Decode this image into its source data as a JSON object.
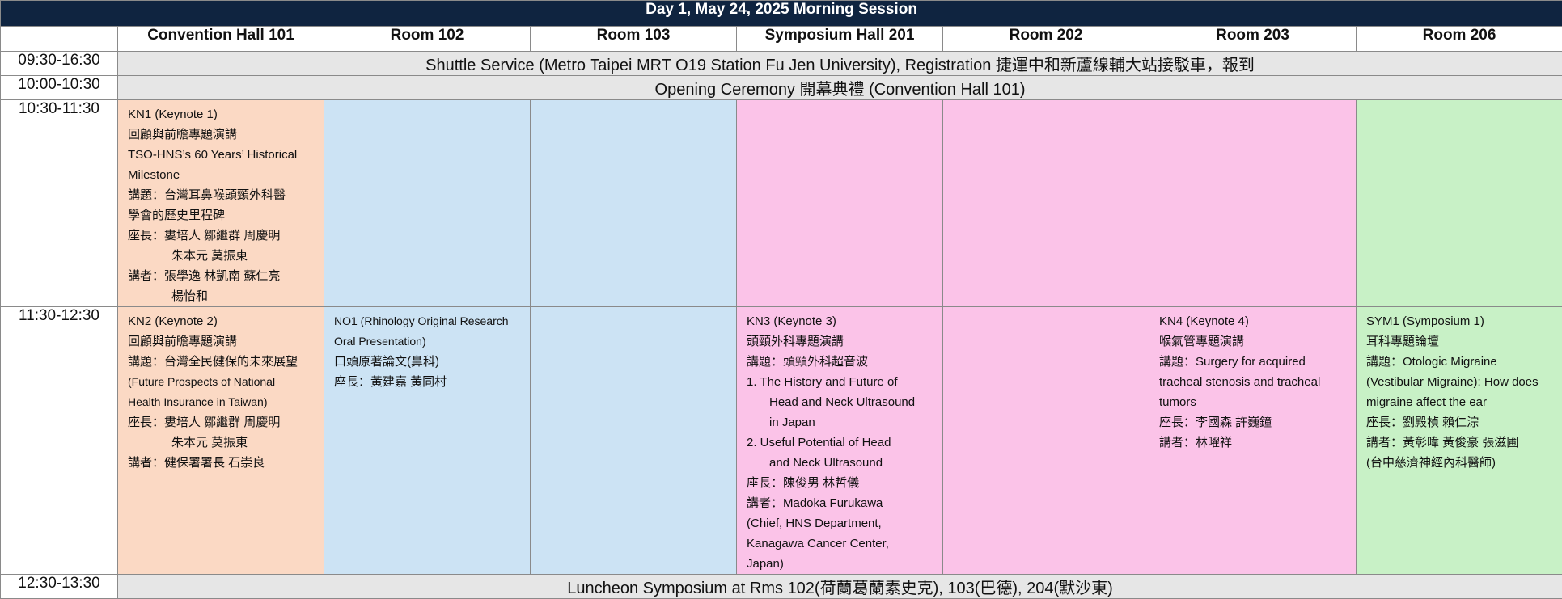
{
  "title": "Day 1, May 24, 2025 Morning Session",
  "rooms": [
    "Convention Hall 101",
    "Room 102",
    "Room 103",
    "Symposium Hall 201",
    "Room 202",
    "Room 203",
    "Room 206"
  ],
  "rows": {
    "shuttle": {
      "time": "09:30-16:30",
      "text": "Shuttle Service (Metro Taipei MRT O19 Station Fu Jen University), Registration  捷運中和新蘆線輔大站接駁車，報到"
    },
    "opening": {
      "time": "10:00-10:30",
      "text": "Opening Ceremony  開幕典禮  (Convention Hall 101)"
    },
    "slot1": {
      "time": "10:30-11:30",
      "kn1": {
        "l1": "KN1 (Keynote 1)",
        "l2": "回顧與前瞻專題演講",
        "l3": "TSO-HNS’s 60 Years’ Historical",
        "l4": "Milestone",
        "l5": "講題：台灣耳鼻喉頭頸外科醫",
        "l6": "學會的歷史里程碑",
        "l7": "座長：婁培人  鄒繼群  周慶明",
        "l8": "朱本元  莫振東",
        "l9": "講者：張學逸  林凱南  蘇仁亮",
        "l10": "楊怡和"
      }
    },
    "slot2": {
      "time": "11:30-12:30",
      "kn2": {
        "l1": "KN2 (Keynote 2)",
        "l2": "回顧與前瞻專題演講",
        "l3": "講題：台灣全民健保的未來展望",
        "l4": "(Future Prospects of National",
        "l5": "Health Insurance in Taiwan)",
        "l6": "座長：婁培人  鄒繼群  周慶明",
        "l7": "朱本元  莫振東",
        "l8": "講者：健保署署長  石崇良"
      },
      "no1": {
        "l1": "NO1 (Rhinology Original Research",
        "l2": "Oral Presentation)",
        "l3": "口頭原著論文(鼻科)",
        "l4": "座長：黃建嘉  黃同村"
      },
      "kn3": {
        "l1": "KN3 (Keynote 3)",
        "l2": "頭頸外科專題演講",
        "l3": "講題：頭頸外科超音波",
        "i1a": "1.    The History and Future of",
        "i1b": "Head and Neck Ultrasound",
        "i1c": "in Japan",
        "i2a": "2.    Useful Potential of Head",
        "i2b": "and Neck Ultrasound",
        "l4": "座長：陳俊男  林哲儀",
        "l5": "講者：Madoka Furukawa",
        "l6": "(Chief, HNS Department,",
        "l7": "Kanagawa Cancer Center,",
        "l8": "Japan)"
      },
      "kn4": {
        "l1": "KN4 (Keynote 4)",
        "l2": "喉氣管專題演講",
        "l3": "講題：Surgery for acquired",
        "l4": "tracheal stenosis and tracheal",
        "l5": "tumors",
        "l6": "座長：李國森  許巍鐘",
        "l7": "講者：林曜祥"
      },
      "sym1": {
        "l1": "SYM1 (Symposium 1)",
        "l2": "耳科專題論壇",
        "l3": "講題：Otologic Migraine",
        "l4": "(Vestibular Migraine): How does",
        "l5": "migraine affect the ear",
        "l6": "座長：劉殿楨  賴仁淙",
        "l7": "講者：黃彰暐  黃俊豪  張滋圃",
        "l8": "(台中慈濟神經內科醫師)"
      }
    },
    "lunch": {
      "time": "12:30-13:30",
      "text": "Luncheon Symposium at Rms 102(荷蘭葛蘭素史克), 103(巴德), 204(默沙東)"
    }
  },
  "colors": {
    "header": "#0f2440",
    "orange": "#fbd9c4",
    "blue": "#cce3f4",
    "pink": "#fbc3e8",
    "green": "#c8f1c6",
    "gray": "#e6e6e6"
  }
}
